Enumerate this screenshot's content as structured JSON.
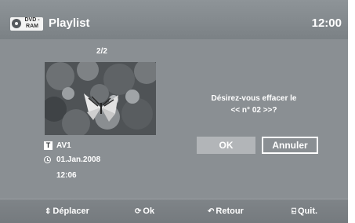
{
  "header": {
    "disc_badge": "DVD -RAM",
    "title": "Playlist",
    "time": "12:00"
  },
  "playlist": {
    "page_indicator": "2/2",
    "item_name": "AV1",
    "item_date": "01.Jan.2008",
    "item_time": "12:06",
    "title_type_icon": "T"
  },
  "dialog": {
    "question_line1": "Désirez-vous effacer le",
    "question_line2": "<< n° 02 >>?",
    "ok_label": "OK",
    "cancel_label": "Annuler"
  },
  "footer": {
    "move": {
      "icon": "⇕",
      "label": "Déplacer"
    },
    "ok": {
      "icon": "⟳",
      "label": "Ok"
    },
    "back": {
      "icon": "↶",
      "label": "Retour"
    },
    "quit": {
      "icon": "⍇",
      "label": "Quit."
    }
  },
  "colors": {
    "panel": "#8a8f93",
    "button_selected": "#b2b5b8",
    "text": "#ffffff"
  }
}
